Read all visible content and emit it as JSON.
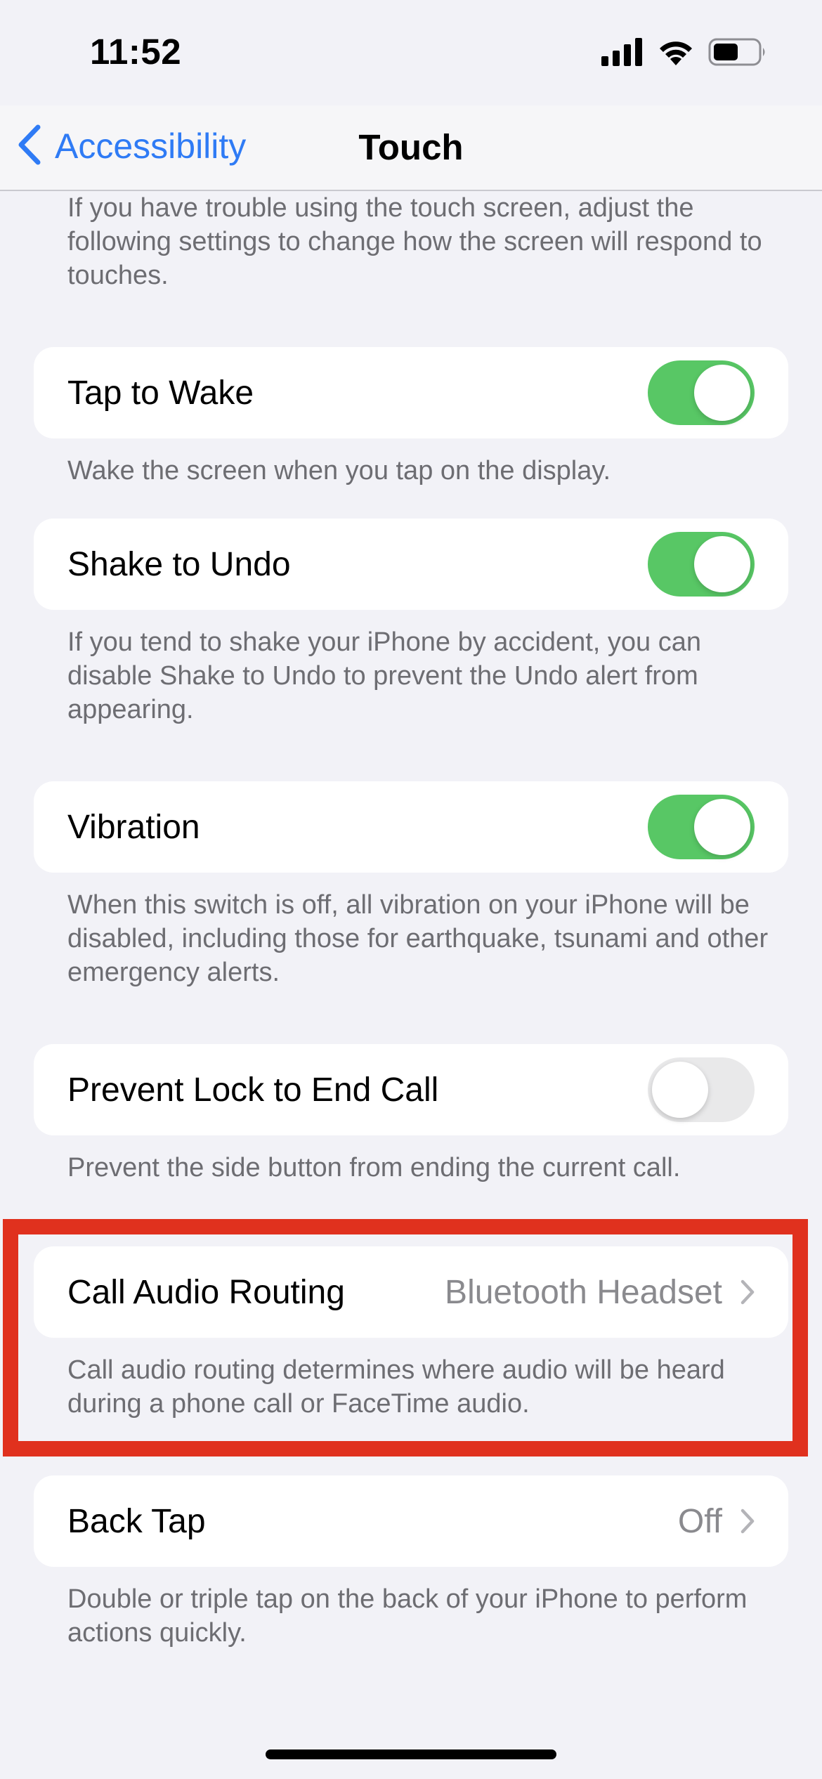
{
  "status_bar": {
    "time": "11:52",
    "icons": [
      "cellular-signal-icon",
      "wifi-icon",
      "battery-icon"
    ]
  },
  "nav": {
    "back_label": "Accessibility",
    "title": "Touch"
  },
  "intro_text": "If you have trouble using the touch screen, adjust the following settings to change how the screen will respond to touches.",
  "settings": [
    {
      "label": "Tap to Wake",
      "type": "toggle",
      "on": true,
      "footer": "Wake the screen when you tap on the display."
    },
    {
      "label": "Shake to Undo",
      "type": "toggle",
      "on": true,
      "footer": "If you tend to shake your iPhone by accident, you can disable Shake to Undo to prevent the Undo alert from appearing."
    },
    {
      "label": "Vibration",
      "type": "toggle",
      "on": true,
      "footer": "When this switch is off, all vibration on your iPhone will be disabled, including those for earthquake, tsunami and other emergency alerts."
    },
    {
      "label": "Prevent Lock to End Call",
      "type": "toggle",
      "on": false,
      "footer": "Prevent the side button from ending the current call."
    },
    {
      "label": "Call Audio Routing",
      "type": "link",
      "value": "Bluetooth Headset",
      "footer": "Call audio routing determines where audio will be heard during a phone call or FaceTime audio."
    },
    {
      "label": "Back Tap",
      "type": "link",
      "value": "Off",
      "footer": "Double or triple tap on the back of your iPhone to perform actions quickly."
    }
  ],
  "colors": {
    "accent": "#2f7bf5",
    "toggle_on": "#58c765",
    "toggle_off": "#e9e9ea",
    "highlight": "#e0311e",
    "background": "#f2f2f7"
  }
}
